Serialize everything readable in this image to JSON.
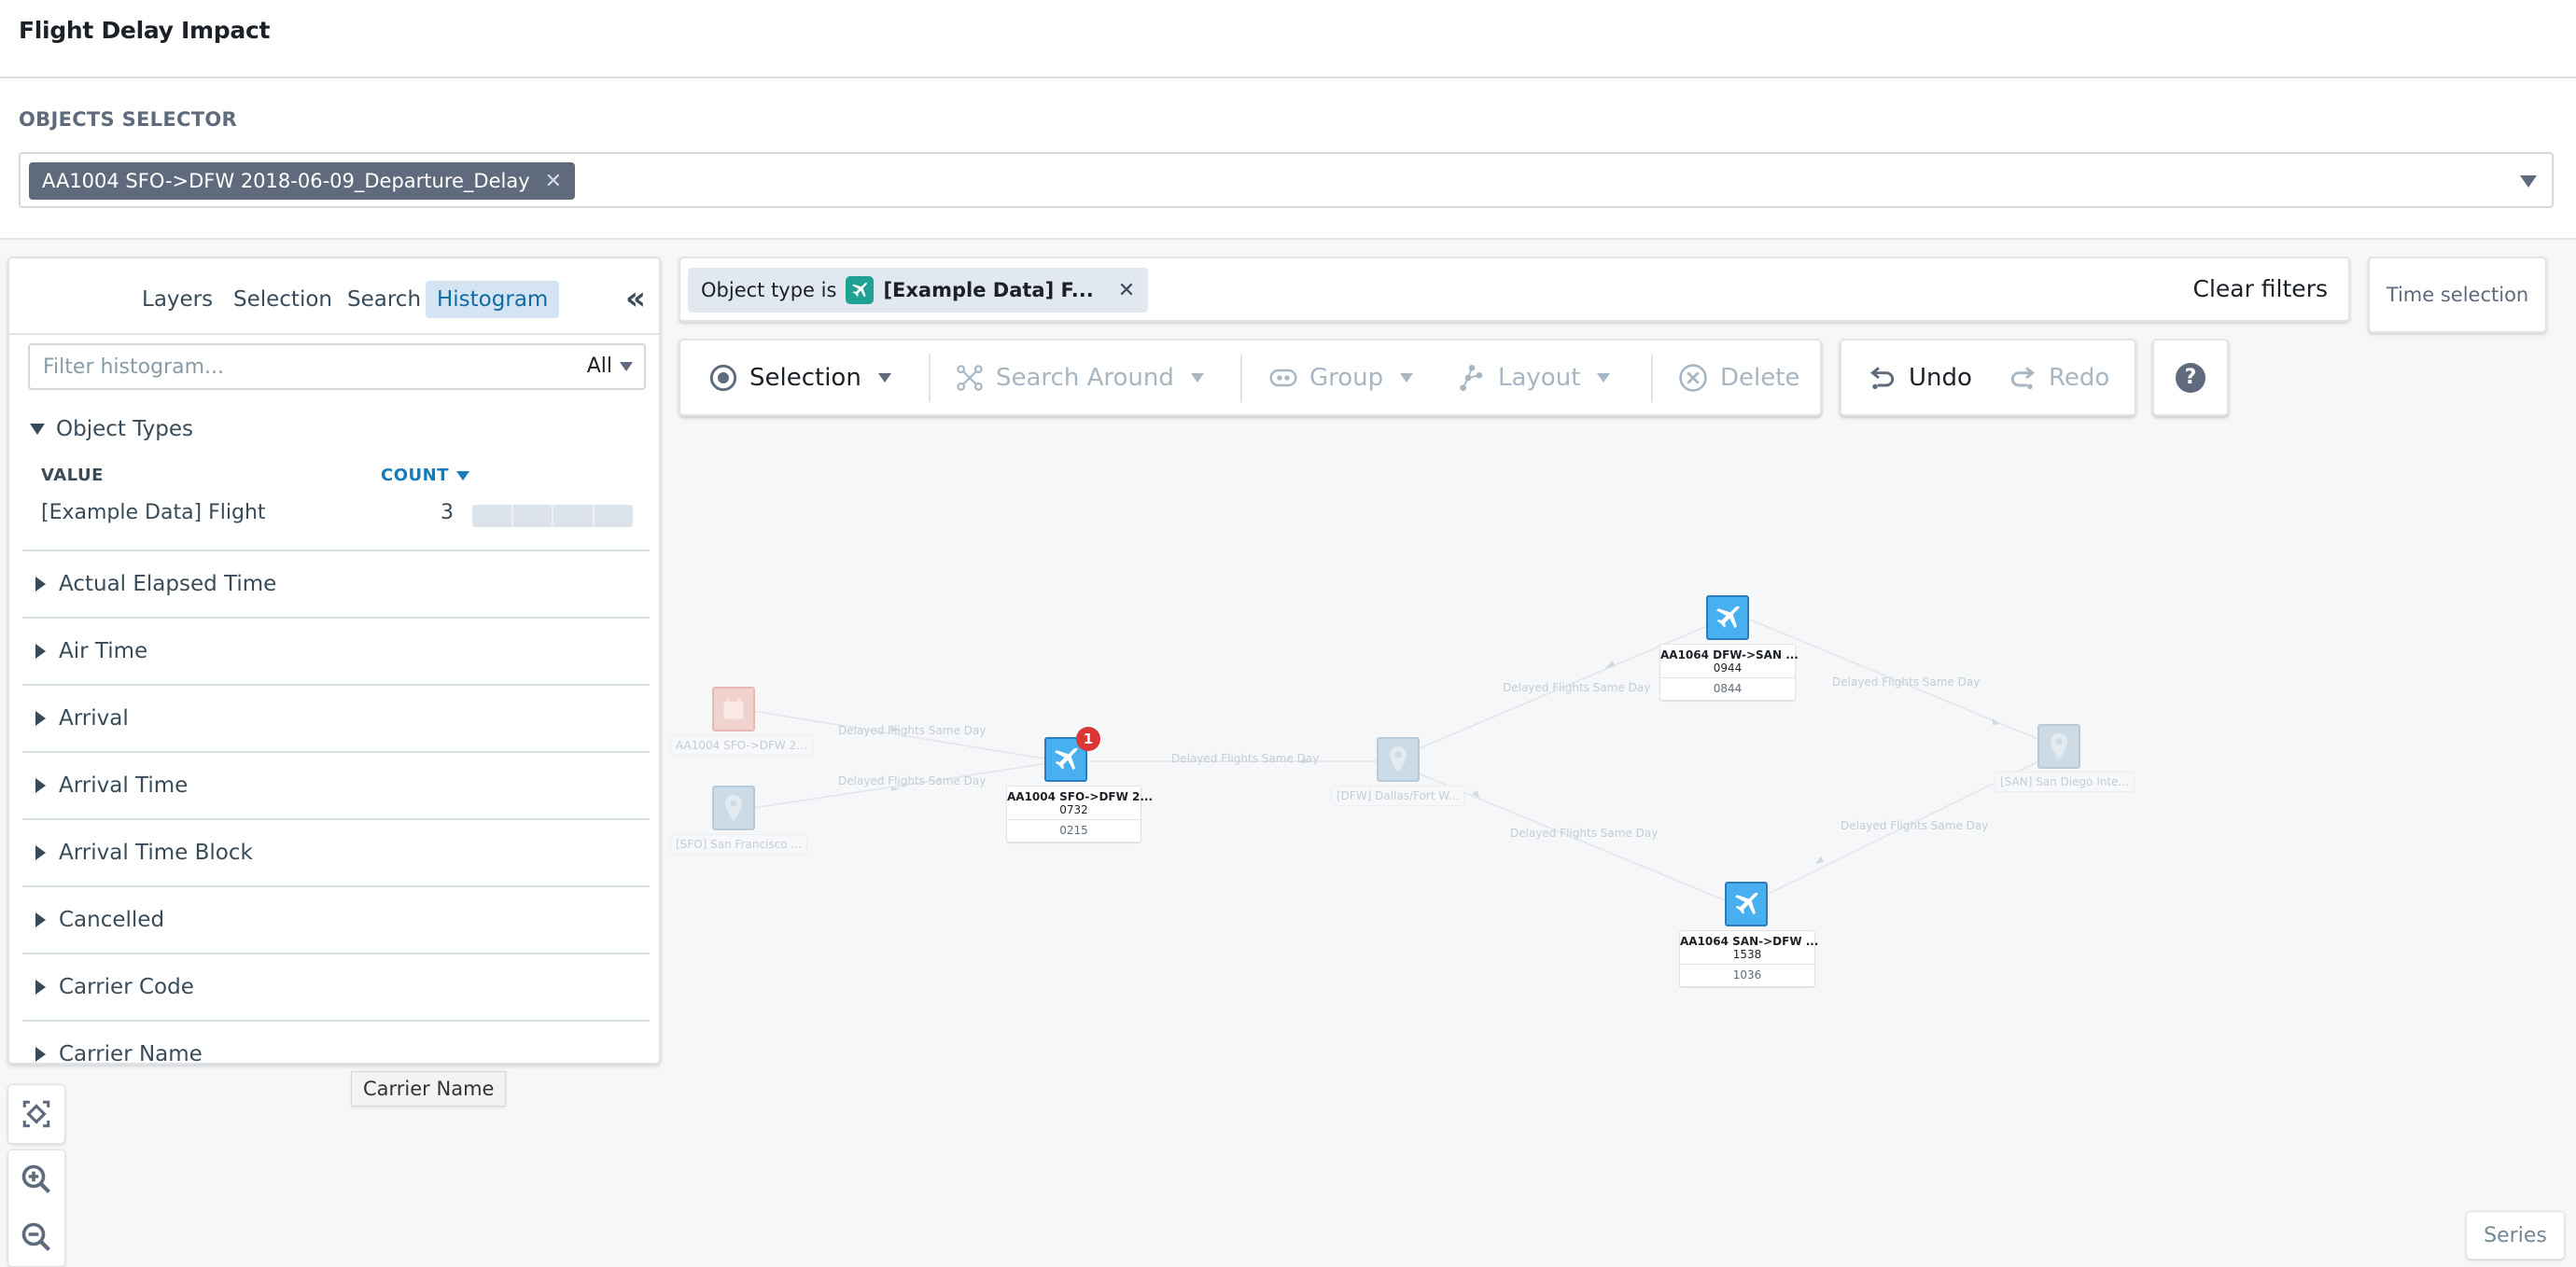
{
  "header": {
    "title": "Flight Delay Impact"
  },
  "objects_selector": {
    "label": "OBJECTS SELECTOR",
    "selected_tag": "AA1004 SFO->DFW 2018-06-09_Departure_Delay",
    "remove_icon": "close-icon",
    "dropdown_icon": "caret-down-icon"
  },
  "left_panel": {
    "tabs": [
      {
        "label": "Layers",
        "active": false
      },
      {
        "label": "Selection",
        "active": false
      },
      {
        "label": "Search",
        "active": false
      },
      {
        "label": "Histogram",
        "active": true
      }
    ],
    "collapse_icon": "double-chevron-left-icon",
    "filter": {
      "placeholder": "Filter histogram...",
      "value": "",
      "scope": "All"
    },
    "object_types": {
      "title": "Object Types",
      "expanded": true,
      "columns": {
        "value": "VALUE",
        "count": "COUNT"
      },
      "rows": [
        {
          "value": "[Example Data] Flight",
          "count": "3"
        }
      ]
    },
    "properties": [
      "Actual Elapsed Time",
      "Air Time",
      "Arrival",
      "Arrival Time",
      "Arrival Time Block",
      "Cancelled",
      "Carrier Code",
      "Carrier Name"
    ]
  },
  "filter_bar": {
    "chip_prefix": "Object type is",
    "chip_icon": "airplane-icon",
    "chip_value": "[Example Data] F...",
    "clear_label": "Clear filters"
  },
  "time_selection": {
    "label": "Time selection"
  },
  "toolbar": {
    "selection": {
      "label": "Selection",
      "icon": "selection-target-icon",
      "enabled": true
    },
    "search_around": {
      "label": "Search Around",
      "icon": "graph-nodes-icon",
      "enabled": false
    },
    "group": {
      "label": "Group",
      "icon": "group-icon",
      "enabled": false
    },
    "layout": {
      "label": "Layout",
      "icon": "layout-icon",
      "enabled": false
    },
    "delete": {
      "label": "Delete",
      "icon": "delete-circle-icon",
      "enabled": false
    },
    "undo": {
      "label": "Undo",
      "icon": "undo-icon",
      "enabled": true
    },
    "redo": {
      "label": "Redo",
      "icon": "redo-icon",
      "enabled": false
    },
    "help_icon": "help-icon"
  },
  "graph": {
    "edge_label": "Delayed Flights Same Day",
    "nodes": {
      "date_node": {
        "label": "AA1004 SFO->DFW 2...",
        "type": "calendar"
      },
      "sfo_node": {
        "label": "[SFO] San Francisco ...",
        "type": "airport"
      },
      "main_flight": {
        "title": "AA1004 SFO->DFW 2...",
        "line2": "0732",
        "line3": "0215",
        "badge": "1",
        "type": "flight"
      },
      "dfw_node": {
        "label": "[DFW] Dallas/Fort W...",
        "type": "airport"
      },
      "flight_dfw_san": {
        "title": "AA1064 DFW->SAN ...",
        "line2": "0944",
        "line3": "0844",
        "type": "flight"
      },
      "san_node": {
        "label": "[SAN] San Diego Inte...",
        "type": "airport"
      },
      "flight_san_dfw": {
        "title": "AA1064 SAN->DFW ...",
        "line2": "1538",
        "line3": "1036",
        "type": "flight"
      }
    }
  },
  "canvas_controls": {
    "fit_icon": "fit-to-screen-icon",
    "zoom_in_icon": "zoom-in-icon",
    "zoom_out_icon": "zoom-out-icon"
  },
  "tooltip": {
    "text": "Carrier Name"
  },
  "series_button": {
    "label": "Series"
  }
}
